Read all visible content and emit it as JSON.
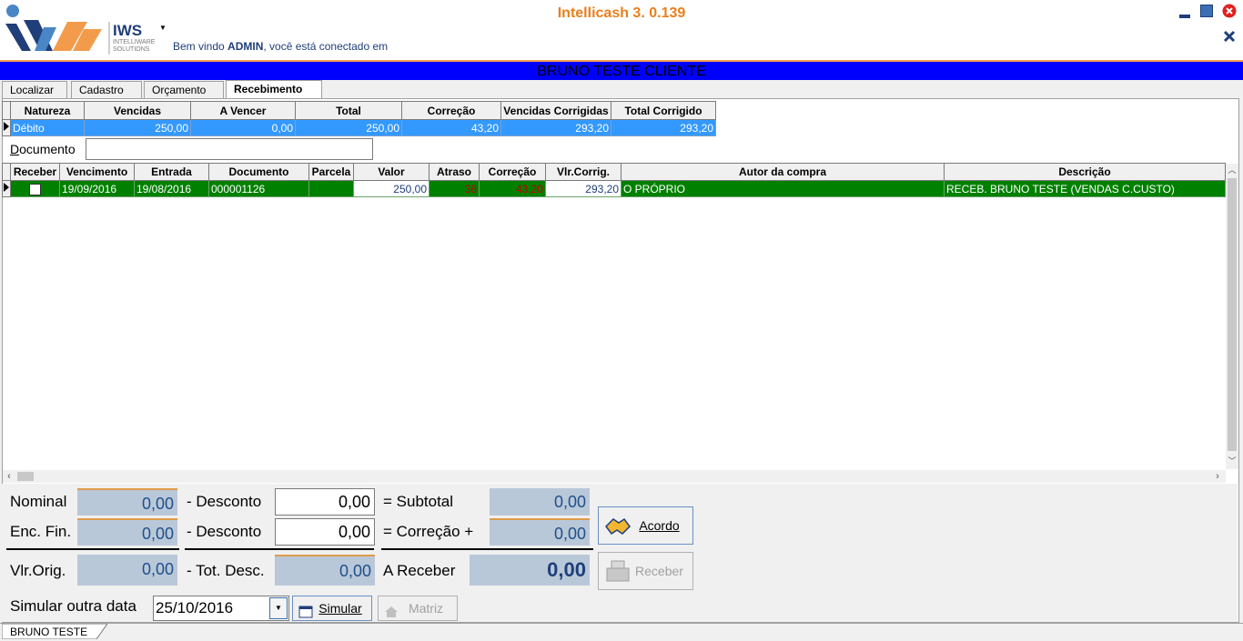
{
  "app": {
    "title": "Intellicash 3. 0.139",
    "logo_text": "IWS",
    "logo_sub": "INTELLIWARE SOLUTIONS",
    "welcome_prefix": "Bem vindo",
    "user": "ADMIN",
    "welcome_suffix": ", você está conectado em"
  },
  "client_band": "BRUNO TESTE CLIENTE",
  "tabs": [
    {
      "label": "Localizar"
    },
    {
      "label": "Cadastro"
    },
    {
      "label": "Orçamento"
    },
    {
      "label": "Recebimento"
    }
  ],
  "summary": {
    "headers": [
      "Natureza",
      "Vencidas",
      "A Vencer",
      "Total",
      "Correção",
      "Vencidas Corrigidas",
      "Total Corrigido"
    ],
    "row": [
      "Débito",
      "250,00",
      "0,00",
      "250,00",
      "43,20",
      "293,20",
      "293,20"
    ]
  },
  "documento": {
    "label": "Documento",
    "value": ""
  },
  "detail": {
    "headers": [
      "Receber",
      "Vencimento",
      "Entrada",
      "Documento",
      "Parcela",
      "Valor",
      "Atraso",
      "Correção",
      "Vlr.Corrig.",
      "Autor da compra",
      "Descrição"
    ],
    "row": {
      "vencimento": "19/09/2016",
      "entrada": "19/08/2016",
      "documento": "000001126",
      "parcela": "",
      "valor": "250,00",
      "atraso": "36",
      "correcao": "43,20",
      "vlr_corrig": "293,20",
      "autor": "O PRÓPRIO",
      "descricao": "RECEB. BRUNO TESTE (VENDAS  C.CUSTO)"
    }
  },
  "totals": {
    "nominal_label": "Nominal",
    "nominal": "0,00",
    "desconto1_label": "- Desconto",
    "desconto1": "0,00",
    "subtotal_label": "= Subtotal",
    "subtotal": "0,00",
    "encfin_label": "Enc. Fin.",
    "encfin": "0,00",
    "desconto2_label": "- Desconto",
    "desconto2": "0,00",
    "correcao_label": "= Correção  +",
    "correcao": "0,00",
    "vlrorig_label": "Vlr.Orig.",
    "vlrorig": "0,00",
    "totdesc_label": "- Tot. Desc.",
    "totdesc": "0,00",
    "areceber_label": "A Receber",
    "areceber": "0,00",
    "simular_label": "Simular outra data",
    "simular_date": "25/10/2016"
  },
  "buttons": {
    "acordo": "Acordo",
    "receber": "Receber",
    "simular": "Simular",
    "matriz": "Matriz"
  },
  "status_tab": "BRUNO TESTE"
}
